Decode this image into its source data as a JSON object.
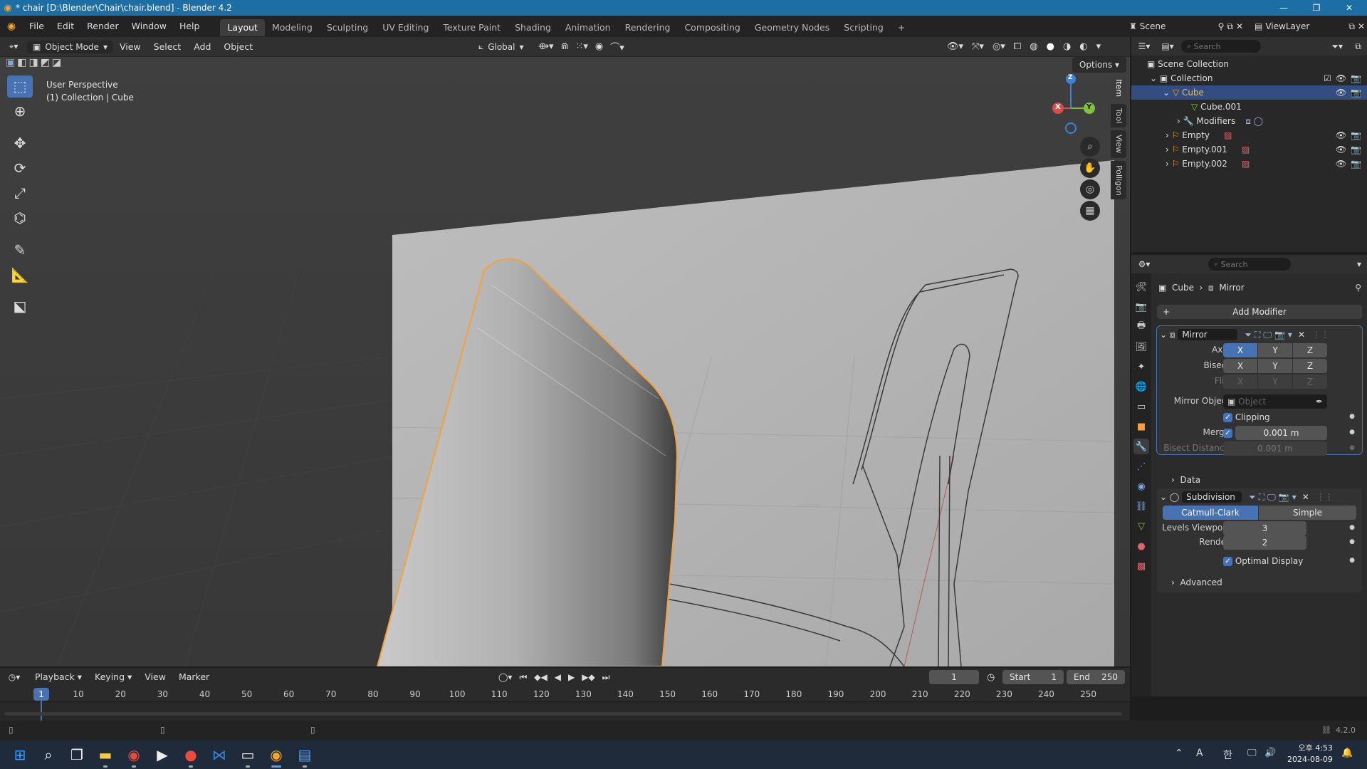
{
  "window": {
    "title": "* chair [D:\\Blender\\Chair\\chair.blend] - Blender 4.2"
  },
  "menus": [
    "File",
    "Edit",
    "Render",
    "Window",
    "Help"
  ],
  "workspaces": [
    "Layout",
    "Modeling",
    "Sculpting",
    "UV Editing",
    "Texture Paint",
    "Shading",
    "Animation",
    "Rendering",
    "Compositing",
    "Geometry Nodes",
    "Scripting"
  ],
  "scene": {
    "name": "Scene",
    "view_layer": "ViewLayer"
  },
  "viewport": {
    "mode": "Object Mode",
    "menus": [
      "View",
      "Select",
      "Add",
      "Object"
    ],
    "orientation": "Global",
    "options_label": "Options",
    "info_line1": "User Perspective",
    "info_line2": "(1) Collection | Cube",
    "side_tabs": [
      "Item",
      "Tool",
      "View",
      "Polligon"
    ],
    "gizmo": {
      "x": "X",
      "y": "Y",
      "z": "Z"
    }
  },
  "outliner": {
    "search_placeholder": "Search",
    "rows": [
      {
        "label": "Scene Collection"
      },
      {
        "label": "Collection"
      },
      {
        "label": "Cube"
      },
      {
        "label": "Cube.001"
      },
      {
        "label": "Modifiers"
      },
      {
        "label": "Empty"
      },
      {
        "label": "Empty.001"
      },
      {
        "label": "Empty.002"
      }
    ]
  },
  "properties": {
    "search_placeholder": "Search",
    "breadcrumb_object": "Cube",
    "breadcrumb_modifier": "Mirror",
    "add_modifier": "Add Modifier",
    "mirror": {
      "name": "Mirror",
      "axis_label": "Axis",
      "bisect_label": "Bisect",
      "flip_label": "Flip",
      "x": "X",
      "y": "Y",
      "z": "Z",
      "mirror_object_label": "Mirror Object",
      "mirror_object_placeholder": "Object",
      "clipping_label": "Clipping",
      "merge_label": "Merge",
      "merge_value": "0.001 m",
      "bisect_distance_label": "Bisect Distance",
      "bisect_distance_value": "0.001 m",
      "data_label": "Data"
    },
    "subdivision": {
      "name": "Subdivision",
      "catmull": "Catmull-Clark",
      "simple": "Simple",
      "levels_viewport_label": "Levels Viewport",
      "levels_viewport_value": "3",
      "render_label": "Render",
      "render_value": "2",
      "optimal_display_label": "Optimal Display",
      "advanced_label": "Advanced"
    }
  },
  "timeline": {
    "menus": [
      "Playback",
      "Keying",
      "View",
      "Marker"
    ],
    "current_frame": "1",
    "start_label": "Start",
    "start_value": "1",
    "end_label": "End",
    "end_value": "250",
    "playhead": "1",
    "ticks": [
      "10",
      "20",
      "30",
      "40",
      "50",
      "60",
      "70",
      "80",
      "90",
      "100",
      "110",
      "120",
      "130",
      "140",
      "150",
      "160",
      "170",
      "180",
      "190",
      "200",
      "210",
      "220",
      "230",
      "240",
      "250"
    ]
  },
  "statusbar": {
    "version": "4.2.0"
  },
  "taskbar": {
    "time": "오후 4:53",
    "date": "2024-08-09",
    "lang": "A",
    "ime": "한"
  },
  "colors": {
    "accent": "#4772b3",
    "titlebar": "#1c6ea4",
    "selected_outline": "#f5a13b"
  }
}
